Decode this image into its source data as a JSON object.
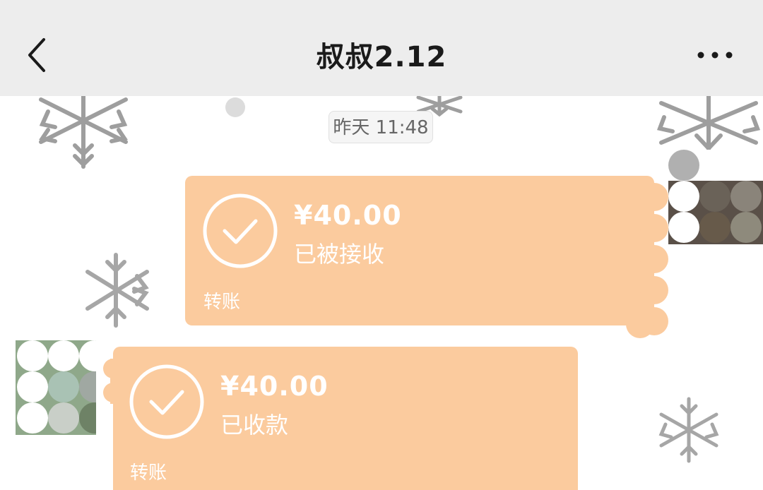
{
  "header": {
    "title": "叔叔2.12",
    "back_icon": "chevron-left-icon",
    "more_icon": "more-dots-icon"
  },
  "chat": {
    "timestamp": "昨天 11:48",
    "messages": [
      {
        "direction": "outgoing",
        "amount": "¥40.00",
        "status": "已被接收",
        "label": "转账",
        "icon": "check-circle-icon"
      },
      {
        "direction": "incoming",
        "amount": "¥40.00",
        "status": "已收款",
        "label": "转账",
        "icon": "check-circle-icon"
      }
    ]
  },
  "colors": {
    "header_bg": "#ededed",
    "transfer_bubble": "#fbcb9e",
    "text_white": "#ffffff"
  }
}
